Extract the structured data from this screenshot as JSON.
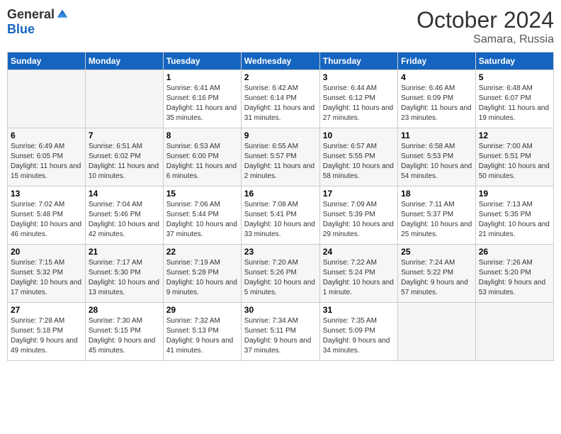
{
  "logo": {
    "general": "General",
    "blue": "Blue"
  },
  "title": "October 2024",
  "location": "Samara, Russia",
  "days_of_week": [
    "Sunday",
    "Monday",
    "Tuesday",
    "Wednesday",
    "Thursday",
    "Friday",
    "Saturday"
  ],
  "weeks": [
    [
      {
        "day": "",
        "info": ""
      },
      {
        "day": "",
        "info": ""
      },
      {
        "day": "1",
        "info": "Sunrise: 6:41 AM\nSunset: 6:16 PM\nDaylight: 11 hours and 35 minutes."
      },
      {
        "day": "2",
        "info": "Sunrise: 6:42 AM\nSunset: 6:14 PM\nDaylight: 11 hours and 31 minutes."
      },
      {
        "day": "3",
        "info": "Sunrise: 6:44 AM\nSunset: 6:12 PM\nDaylight: 11 hours and 27 minutes."
      },
      {
        "day": "4",
        "info": "Sunrise: 6:46 AM\nSunset: 6:09 PM\nDaylight: 11 hours and 23 minutes."
      },
      {
        "day": "5",
        "info": "Sunrise: 6:48 AM\nSunset: 6:07 PM\nDaylight: 11 hours and 19 minutes."
      }
    ],
    [
      {
        "day": "6",
        "info": "Sunrise: 6:49 AM\nSunset: 6:05 PM\nDaylight: 11 hours and 15 minutes."
      },
      {
        "day": "7",
        "info": "Sunrise: 6:51 AM\nSunset: 6:02 PM\nDaylight: 11 hours and 10 minutes."
      },
      {
        "day": "8",
        "info": "Sunrise: 6:53 AM\nSunset: 6:00 PM\nDaylight: 11 hours and 6 minutes."
      },
      {
        "day": "9",
        "info": "Sunrise: 6:55 AM\nSunset: 5:57 PM\nDaylight: 11 hours and 2 minutes."
      },
      {
        "day": "10",
        "info": "Sunrise: 6:57 AM\nSunset: 5:55 PM\nDaylight: 10 hours and 58 minutes."
      },
      {
        "day": "11",
        "info": "Sunrise: 6:58 AM\nSunset: 5:53 PM\nDaylight: 10 hours and 54 minutes."
      },
      {
        "day": "12",
        "info": "Sunrise: 7:00 AM\nSunset: 5:51 PM\nDaylight: 10 hours and 50 minutes."
      }
    ],
    [
      {
        "day": "13",
        "info": "Sunrise: 7:02 AM\nSunset: 5:48 PM\nDaylight: 10 hours and 46 minutes."
      },
      {
        "day": "14",
        "info": "Sunrise: 7:04 AM\nSunset: 5:46 PM\nDaylight: 10 hours and 42 minutes."
      },
      {
        "day": "15",
        "info": "Sunrise: 7:06 AM\nSunset: 5:44 PM\nDaylight: 10 hours and 37 minutes."
      },
      {
        "day": "16",
        "info": "Sunrise: 7:08 AM\nSunset: 5:41 PM\nDaylight: 10 hours and 33 minutes."
      },
      {
        "day": "17",
        "info": "Sunrise: 7:09 AM\nSunset: 5:39 PM\nDaylight: 10 hours and 29 minutes."
      },
      {
        "day": "18",
        "info": "Sunrise: 7:11 AM\nSunset: 5:37 PM\nDaylight: 10 hours and 25 minutes."
      },
      {
        "day": "19",
        "info": "Sunrise: 7:13 AM\nSunset: 5:35 PM\nDaylight: 10 hours and 21 minutes."
      }
    ],
    [
      {
        "day": "20",
        "info": "Sunrise: 7:15 AM\nSunset: 5:32 PM\nDaylight: 10 hours and 17 minutes."
      },
      {
        "day": "21",
        "info": "Sunrise: 7:17 AM\nSunset: 5:30 PM\nDaylight: 10 hours and 13 minutes."
      },
      {
        "day": "22",
        "info": "Sunrise: 7:19 AM\nSunset: 5:28 PM\nDaylight: 10 hours and 9 minutes."
      },
      {
        "day": "23",
        "info": "Sunrise: 7:20 AM\nSunset: 5:26 PM\nDaylight: 10 hours and 5 minutes."
      },
      {
        "day": "24",
        "info": "Sunrise: 7:22 AM\nSunset: 5:24 PM\nDaylight: 10 hours and 1 minute."
      },
      {
        "day": "25",
        "info": "Sunrise: 7:24 AM\nSunset: 5:22 PM\nDaylight: 9 hours and 57 minutes."
      },
      {
        "day": "26",
        "info": "Sunrise: 7:26 AM\nSunset: 5:20 PM\nDaylight: 9 hours and 53 minutes."
      }
    ],
    [
      {
        "day": "27",
        "info": "Sunrise: 7:28 AM\nSunset: 5:18 PM\nDaylight: 9 hours and 49 minutes."
      },
      {
        "day": "28",
        "info": "Sunrise: 7:30 AM\nSunset: 5:15 PM\nDaylight: 9 hours and 45 minutes."
      },
      {
        "day": "29",
        "info": "Sunrise: 7:32 AM\nSunset: 5:13 PM\nDaylight: 9 hours and 41 minutes."
      },
      {
        "day": "30",
        "info": "Sunrise: 7:34 AM\nSunset: 5:11 PM\nDaylight: 9 hours and 37 minutes."
      },
      {
        "day": "31",
        "info": "Sunrise: 7:35 AM\nSunset: 5:09 PM\nDaylight: 9 hours and 34 minutes."
      },
      {
        "day": "",
        "info": ""
      },
      {
        "day": "",
        "info": ""
      }
    ]
  ]
}
